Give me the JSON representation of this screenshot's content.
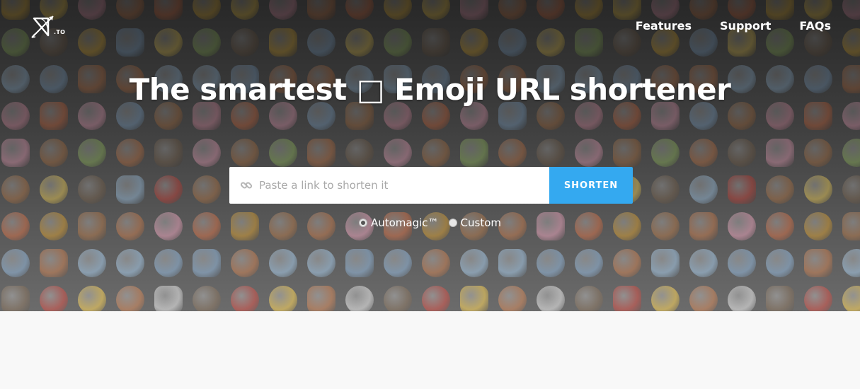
{
  "header": {
    "logo_text": ".TO",
    "nav": [
      {
        "label": "Features"
      },
      {
        "label": "Support"
      },
      {
        "label": "FAQs"
      }
    ]
  },
  "hero": {
    "headline": "The smartest □ Emoji URL shortener",
    "input": {
      "placeholder": "Paste a link to shorten it",
      "value": ""
    },
    "shorten_button": "SHORTEN",
    "options": [
      {
        "label": "Automagic™",
        "selected": true
      },
      {
        "label": "Custom",
        "selected": false
      }
    ]
  },
  "colors": {
    "accent": "#34a9f0",
    "text_on_dark": "#ffffff",
    "page_background": "#f8f8f8"
  },
  "icons": [
    "bow-and-arrow-logo-icon",
    "link-icon",
    "radio-icon"
  ]
}
